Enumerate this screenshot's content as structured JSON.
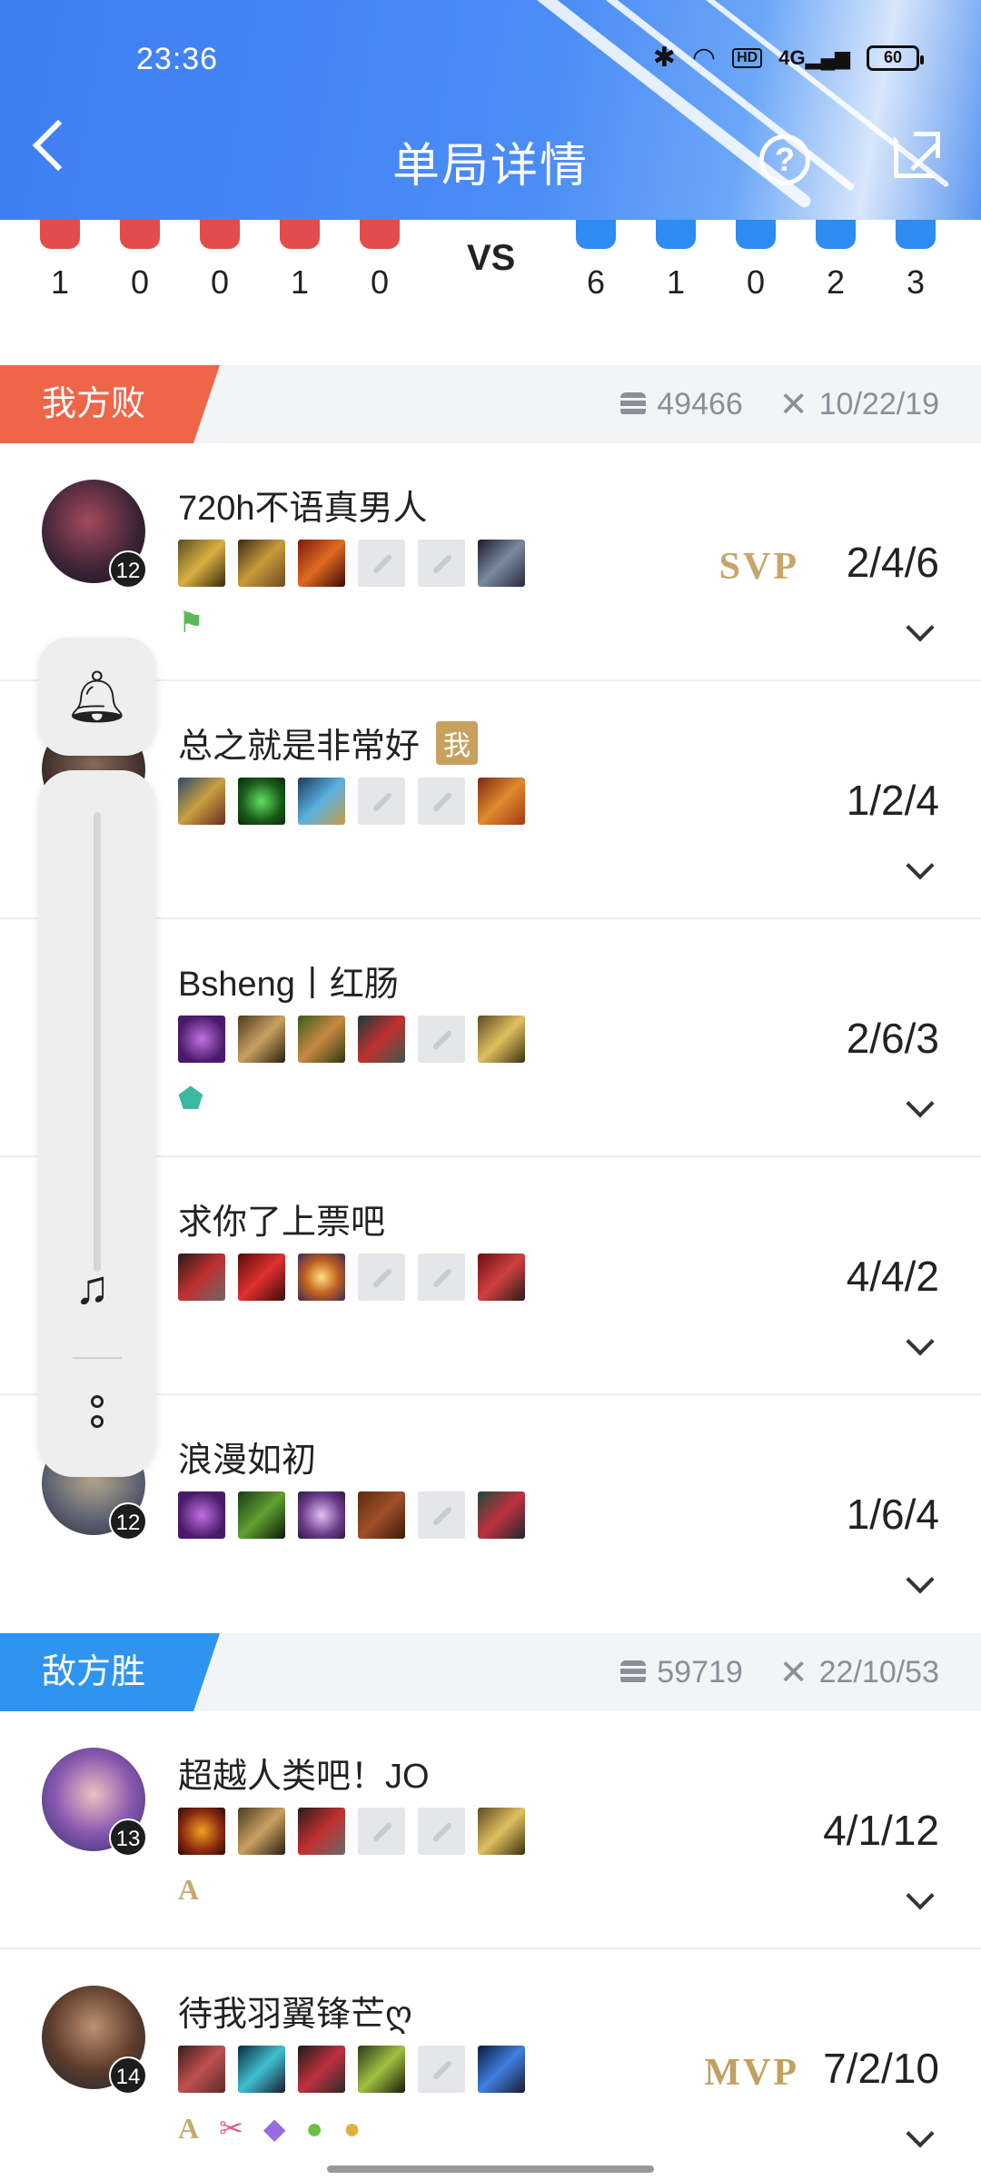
{
  "status_bar": {
    "time": "23:36",
    "battery": "60",
    "hd": "HD",
    "network": "4G"
  },
  "header": {
    "title": "单局详情"
  },
  "score": {
    "vs": "VS",
    "red": [
      "1",
      "0",
      "0",
      "1",
      "0"
    ],
    "blue": [
      "6",
      "1",
      "0",
      "2",
      "3"
    ]
  },
  "my_team": {
    "label": "我方败",
    "gold": "49466",
    "kda": "10/22/19",
    "players": [
      {
        "name": "720h不语真男人",
        "level": "12",
        "kda": "2/4/6",
        "honor": "SVP",
        "me": ""
      },
      {
        "name": "总之就是非常好",
        "level": "",
        "kda": "1/2/4",
        "honor": "",
        "me": "我"
      },
      {
        "name": "Bsheng丨红肠",
        "level": "",
        "kda": "2/6/3",
        "honor": "",
        "me": ""
      },
      {
        "name": "求你了上票吧",
        "level": "",
        "kda": "4/4/2",
        "honor": "",
        "me": ""
      },
      {
        "name": "浪漫如初",
        "level": "12",
        "kda": "1/6/4",
        "honor": "",
        "me": ""
      }
    ]
  },
  "enemy_team": {
    "label": "敌方胜",
    "gold": "59719",
    "kda": "22/10/53",
    "players": [
      {
        "name": "超越人类吧！JO",
        "level": "13",
        "kda": "4/1/12",
        "honor": "",
        "badge": "A"
      },
      {
        "name": "待我羽翼锋芒ღ",
        "level": "14",
        "kda": "7/2/10",
        "honor": "MVP",
        "badge": "A"
      }
    ]
  },
  "colors": {
    "lose": "#ee6548",
    "win": "#2f94ef",
    "header": "#3d7ef2"
  }
}
